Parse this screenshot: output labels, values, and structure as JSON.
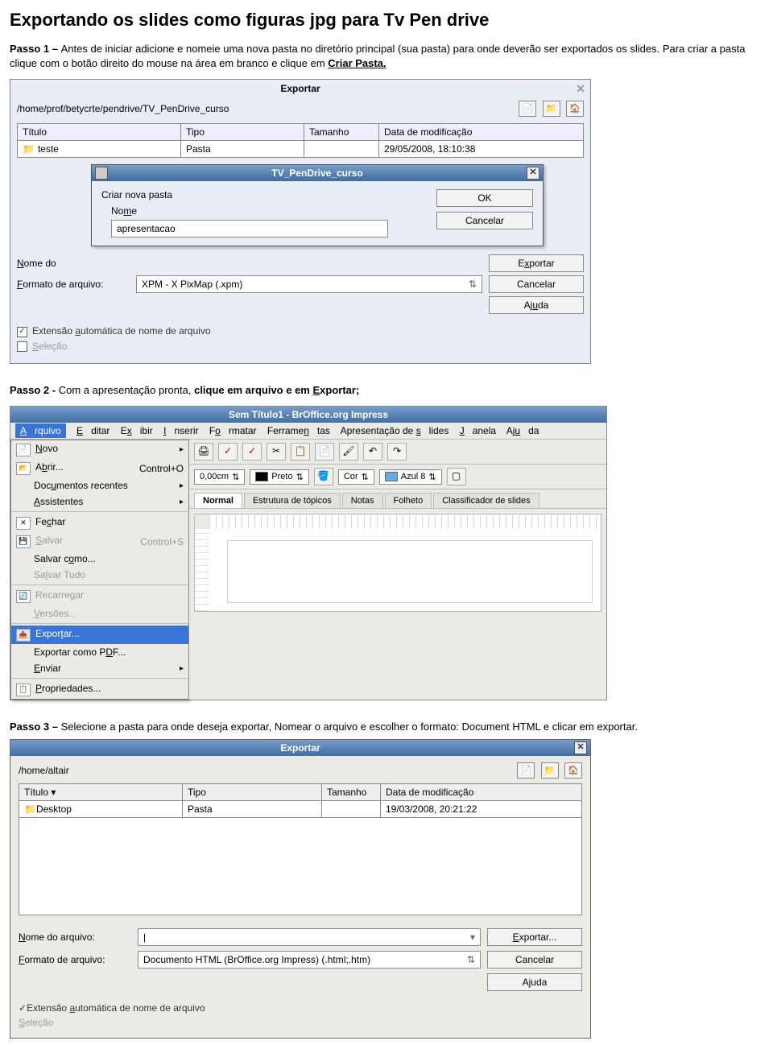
{
  "page": {
    "title": "Exportando os slides como figuras jpg para Tv Pen drive",
    "step1_label": "Passo 1 – ",
    "step1_text_a": "Antes de iniciar adicione e nomeie uma nova pasta no diretório principal (sua pasta) para onde deverão ser exportados os slides. Para criar a pasta clique com o botão direito do mouse na área em branco e clique em ",
    "step1_link": "Criar Pasta.",
    "step2_label": "Passo 2 - ",
    "step2_text_a": "Com a apresentação pronta, ",
    "step2_bold": "clique em arquivo e em Exportar;",
    "step3_label": "Passo 3 – ",
    "step3_text": "Selecione a pasta para onde deseja exportar, Nomear o arquivo e escolher o formato: Document HTML e clicar em exportar."
  },
  "dialog1": {
    "title": "Exportar",
    "path": "/home/prof/betycrte/pendrive/TV_PenDrive_curso",
    "icons": {
      "new": "📄",
      "up": "📁",
      "home": "🏠"
    },
    "cols": {
      "title": "Título",
      "type": "Tipo",
      "size": "Tamanho",
      "date": "Data de modificação"
    },
    "row": {
      "name": "teste",
      "type": "Pasta",
      "size": "",
      "date": "29/05/2008, 18:10:38"
    },
    "inner": {
      "wintitle": "TV_PenDrive_curso",
      "legend": "Criar nova pasta",
      "label": "Nome",
      "value": "apresentacao",
      "ok": "OK",
      "cancel": "Cancelar"
    },
    "bottom": {
      "name_lab": "Nome do",
      "name_val": "",
      "format_lab": "Formato de arquivo:",
      "format_val": "XPM - X PixMap (.xpm)",
      "export_btn": "Exportar",
      "cancel_btn": "Cancelar",
      "help_btn": "Ajuda",
      "check1": "Extensão automática de nome de arquivo",
      "check2": "Seleção"
    }
  },
  "impress": {
    "title": "Sem Título1 - BrOffice.org Impress",
    "menubar": [
      "Arquivo",
      "Editar",
      "Exibir",
      "Inserir",
      "Formatar",
      "Ferramentas",
      "Apresentação de slides",
      "Janela",
      "Ajuda"
    ],
    "menu": [
      {
        "label": "Novo",
        "arrow": "▸",
        "disabled": false
      },
      {
        "label": "Abrir...",
        "short": "Control+O"
      },
      {
        "label": "Documentos recentes",
        "arrow": "▸"
      },
      {
        "label": "Assistentes",
        "arrow": "▸"
      },
      {
        "sep": true
      },
      {
        "label": "Fechar"
      },
      {
        "label": "Salvar",
        "short": "Control+S",
        "disabled": true
      },
      {
        "label": "Salvar como..."
      },
      {
        "label": "Salvar Tudo",
        "disabled": true
      },
      {
        "sep": true
      },
      {
        "label": "Recarregar",
        "disabled": true
      },
      {
        "label": "Versões...",
        "disabled": true
      },
      {
        "sep": true
      },
      {
        "label": "Exportar...",
        "hi": true
      },
      {
        "label": "Exportar como PDF..."
      },
      {
        "label": "Enviar",
        "arrow": "▸"
      },
      {
        "sep": true
      },
      {
        "label": "Propriedades..."
      }
    ],
    "toolbar2": {
      "width": "0,00cm",
      "colname": "Preto",
      "fill_label": "Cor",
      "fill_name": "Azul 8"
    },
    "tabs": [
      "Normal",
      "Estrutura de tópicos",
      "Notas",
      "Folheto",
      "Classificador de slides"
    ]
  },
  "dialog3": {
    "title": "Exportar",
    "path": "/home/altair",
    "cols": {
      "title": "Título",
      "type": "Tipo",
      "size": "Tamanho",
      "date": "Data de modificação"
    },
    "row": {
      "name": "Desktop",
      "type": "Pasta",
      "size": "",
      "date": "19/03/2008, 20:21:22"
    },
    "bottom": {
      "name_lab": "Nome do arquivo:",
      "name_val": "|",
      "format_lab": "Formato de arquivo:",
      "format_val": "Documento HTML (BrOffice.org Impress) (.html;.htm)",
      "export_btn": "Exportar...",
      "cancel_btn": "Cancelar",
      "help_btn": "Ajuda",
      "check1": "Extensão automática de nome de arquivo",
      "check2": "Seleção"
    }
  }
}
